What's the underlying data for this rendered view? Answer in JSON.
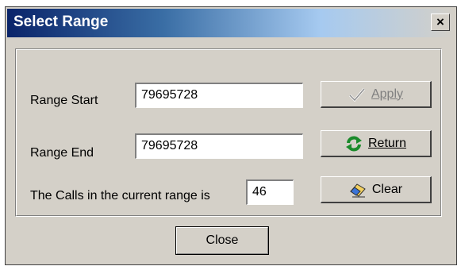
{
  "window": {
    "title": "Select Range",
    "close_glyph": "×"
  },
  "fields": {
    "range_start": {
      "label": "Range Start",
      "value": "79695728"
    },
    "range_end": {
      "label": "Range End",
      "value": "79695728"
    },
    "calls_count": {
      "label": "The Calls in the current range is",
      "value": "46"
    }
  },
  "buttons": {
    "apply": {
      "label": "Apply",
      "icon": "checkmark-icon",
      "enabled": false
    },
    "return": {
      "label": "Return",
      "icon": "refresh-icon",
      "enabled": true
    },
    "clear": {
      "label": "Clear",
      "icon": "eraser-icon",
      "enabled": true
    },
    "close": {
      "label": "Close"
    }
  },
  "colors": {
    "titlebar_start": "#0a246a",
    "dialog_face": "#d4d0c8",
    "disabled_text": "#808080",
    "refresh_green": "#1a8a2a"
  }
}
